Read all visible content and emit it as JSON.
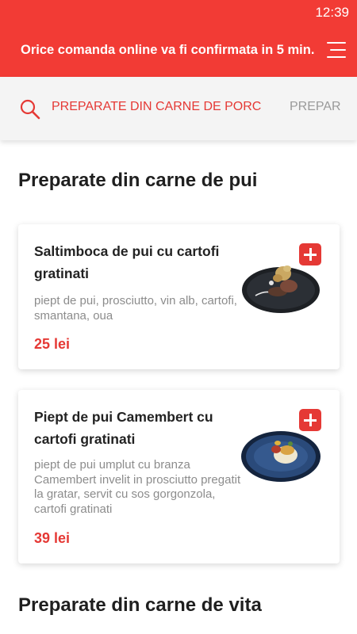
{
  "status_bar": {
    "time": "12:39"
  },
  "header": {
    "banner": "Orice comanda online va fi confirmata in 5 min.",
    "menu_icon": "hamburger-menu-icon"
  },
  "category_bar": {
    "search_icon": "search-icon",
    "tabs": [
      {
        "label": "PREPARATE DIN CARNE DE PORC",
        "active": true
      },
      {
        "label": "PREPAR",
        "active": false
      }
    ]
  },
  "sections": [
    {
      "title": "Preparate din carne de pui",
      "items": [
        {
          "name": "Saltimboca de pui cu cartofi gratinati",
          "description": "piept de pui, prosciutto, vin alb, cartofi, smantana, oua",
          "price": "25 lei",
          "add_icon": "plus-icon"
        },
        {
          "name": "Piept de pui Camembert cu cartofi gratinati",
          "description": "piept de pui umplut cu branza Camembert invelit in prosciutto pregatit la gratar, servit cu sos gorgonzola, cartofi gratinati",
          "price": "39 lei",
          "add_icon": "plus-icon"
        }
      ]
    },
    {
      "title": "Preparate din carne de vita",
      "items": []
    }
  ],
  "colors": {
    "brand_red": "#f23b35",
    "price_red": "#e53935",
    "category_bar_bg": "#f4f4f4"
  }
}
